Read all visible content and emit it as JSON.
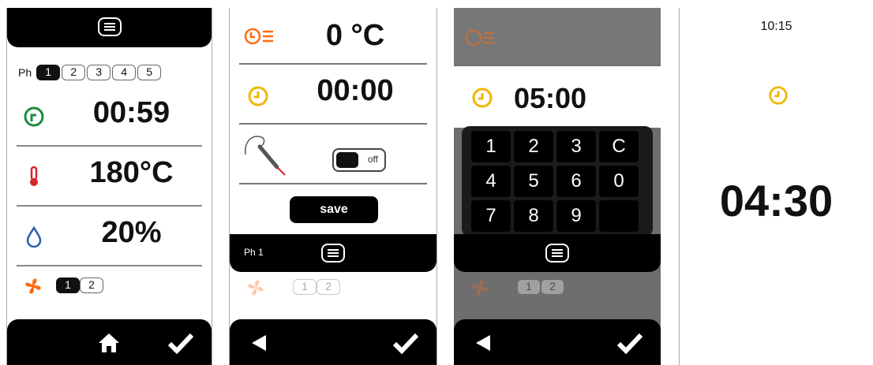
{
  "colors": {
    "orange": "#ff6a13",
    "yellow": "#f2b600",
    "green": "#198d3c",
    "red": "#d6262c",
    "blue": "#2b5fb0"
  },
  "screen1": {
    "ph_label": "Ph",
    "phases": [
      "1",
      "2",
      "3",
      "4",
      "5"
    ],
    "active_phase": "1",
    "time_value": "00:59",
    "temp_value": "180°C",
    "humidity_value": "20%",
    "fan_levels": [
      "1",
      "2"
    ],
    "active_fan": "1"
  },
  "screen2": {
    "temp_value": "0 °C",
    "time_value": "00:00",
    "toggle_label": "off",
    "save_label": "save",
    "ph_label": "Ph 1"
  },
  "screen3": {
    "time_value": "05:00",
    "keys": [
      "1",
      "2",
      "3",
      "C",
      "4",
      "5",
      "6",
      "0",
      "7",
      "8",
      "9",
      ""
    ]
  },
  "screen4": {
    "clock": "10:15",
    "remaining": "04:30"
  }
}
